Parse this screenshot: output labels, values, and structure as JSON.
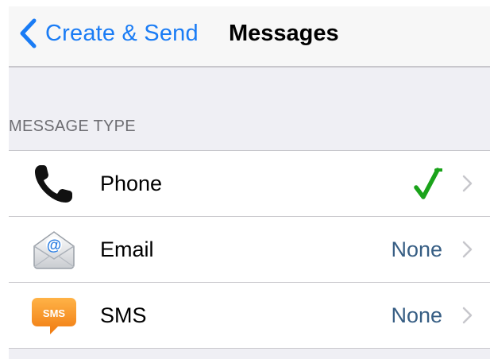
{
  "navbar": {
    "back_label": "Create & Send",
    "title": "Messages"
  },
  "section": {
    "header": "MESSAGE TYPE"
  },
  "rows": [
    {
      "label": "Phone",
      "value": "",
      "selected": true,
      "icon": "phone-icon"
    },
    {
      "label": "Email",
      "value": "None",
      "selected": false,
      "icon": "email-icon"
    },
    {
      "label": "SMS",
      "value": "None",
      "selected": false,
      "icon": "sms-icon",
      "icon_text": "SMS"
    }
  ],
  "colors": {
    "link_blue": "#1a7cf5",
    "value_blue": "#375e84",
    "check_green": "#1aa31a",
    "sms_orange": "#f5941e",
    "background": "#efeff4"
  }
}
